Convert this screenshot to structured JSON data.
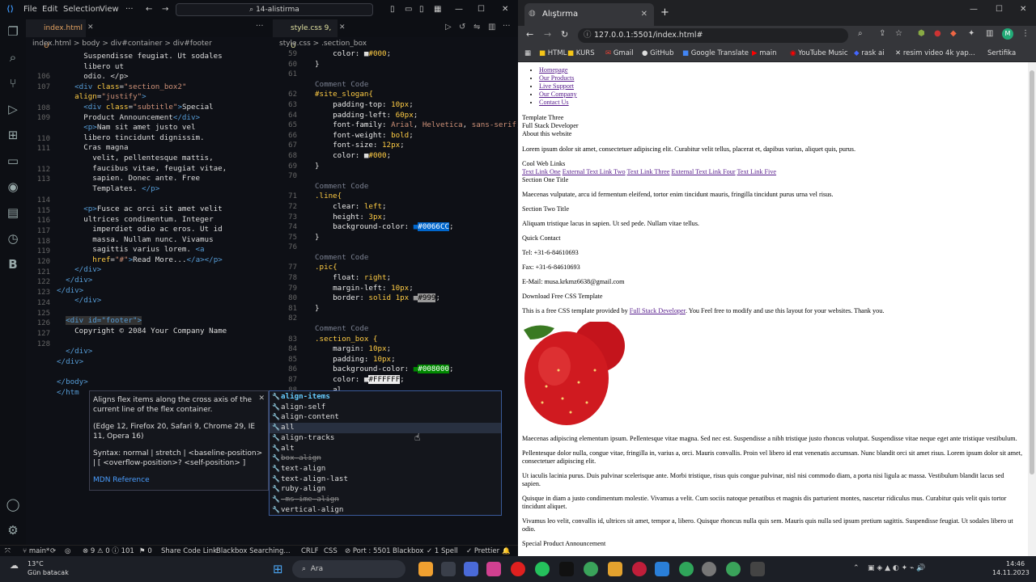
{
  "vscode": {
    "menu": [
      "File",
      "Edit",
      "Selection",
      "View"
    ],
    "search": "14-alistirma",
    "left_tab": "index.html U",
    "right_tab": "style.css 9, U",
    "left_crumb": "index.html > body > div#container > div#footer",
    "right_crumb": "style.css > .section_box",
    "left_gutter": [
      "",
      "",
      "106",
      "107",
      "",
      "108",
      "109",
      "",
      "110",
      "111",
      "",
      "112",
      "113",
      "",
      "114",
      "115",
      "116",
      "117",
      "118",
      "119",
      "120",
      "121",
      "122",
      "123",
      "124",
      "125",
      "126",
      "127",
      "128"
    ],
    "right_gutter": [
      "59",
      "60",
      "61",
      "",
      "62",
      "63",
      "64",
      "65",
      "66",
      "67",
      "68",
      "69",
      "70",
      "",
      "71",
      "72",
      "73",
      "74",
      "75",
      "76",
      "",
      "77",
      "78",
      "79",
      "80",
      "81",
      "82",
      "",
      "83",
      "84",
      "85",
      "86",
      "87",
      "88"
    ],
    "status": {
      "branch": "main*",
      "errors": "9",
      "warnings": "0",
      "info": "101",
      "ports": "0",
      "share": "Share Code Link",
      "blackbox": "Blackbox Searching...",
      "crlf": "CRLF",
      "lang": "CSS",
      "port": "Port : 5501",
      "bb": "Blackbox",
      "spell": "1 Spell",
      "prettier": "Prettier"
    }
  },
  "hover": {
    "desc": "Aligns flex items along the cross axis of the current line of the flex container.",
    "compat": "(Edge 12, Firefox 20, Safari 9, Chrome 29, IE 11, Opera 16)",
    "syntax": "Syntax: normal | stretch | <baseline-position> | [ <overflow-position>? <self-position> ]",
    "link": "MDN Reference"
  },
  "suggestions": [
    "align-items",
    "align-self",
    "align-content",
    "all",
    "align-tracks",
    "alt",
    "box-align",
    "text-align",
    "text-align-last",
    "ruby-align",
    "-ms-ime-align",
    "vertical-align"
  ],
  "browser": {
    "tab_title": "Alıştırma",
    "url": "127.0.0.1:5501/index.html#",
    "bookmarks": [
      "HTML",
      "KURS",
      "Gmail",
      "GitHub",
      "Google Translate",
      "main",
      "YouTube Music",
      "rask ai",
      "resim video 4k yap...",
      "Sertifika"
    ],
    "nav": [
      "Homepage",
      "Our Products",
      "Live Support",
      "Our Company",
      "Contact Us"
    ],
    "template": "Template Three",
    "fullstack": "Full Stack Developer",
    "about": "About this website",
    "lorem1": "Lorem ipsum dolor sit amet, consectetuer adipiscing elit. Curabitur velit tellus, placerat et, dapibus varius, aliquet quis, purus.",
    "cool": "Cool Web Links",
    "links": [
      "Text Link One",
      "External Text Link Two",
      "Text Link Three",
      "External Text Link Four",
      "Text Link Five"
    ],
    "sec1": "Section One Title",
    "sec1_text": "Maecenas vulputate, arcu id fermentum eleifend, tortor enim tincidunt mauris, fringilla tincidunt purus urna vel risus.",
    "sec2": "Section Two Title",
    "sec2_text": "Aliquam tristique lacus in sapien. Ut sed pede. Nullam vitae tellus.",
    "quick": "Quick Contact",
    "tel": "Tel: +31-6-84610693",
    "fax": "Fax: +31-6-84610693",
    "email": "E-Mail: musa.krkmz6638@gmail.com",
    "download": "Download Free CSS Template",
    "free_a": "This is a free CSS template provided by ",
    "free_link": "Full Stack Developer",
    "free_b": ". You Feel free to modify and use this layout for your websites. Thank you.",
    "p1": "Maecenas adipiscing elementum ipsum. Pellentesque vitae magna. Sed nec est. Suspendisse a nibh tristique justo rhoncus volutpat. Suspendisse vitae neque eget ante tristique vestibulum.",
    "p2": "Pellentesque dolor nulla, congue vitae, fringilla in, varius a, orci. Mauris convallis. Proin vel libero id erat venenatis accumsan. Nunc blandit orci sit amet risus. Lorem ipsum dolor sit amet, consectetuer adipiscing elit.",
    "p3": "Ut iaculis lacinia purus. Duis pulvinar scelerisque ante. Morbi tristique, risus quis congue pulvinar, nisl nisi commodo diam, a porta nisi ligula ac massa. Vestibulum blandit lacus sed sapien.",
    "p4": "Quisque in diam a justo condimentum molestie. Vivamus a velit. Cum sociis natoque penatibus et magnis dis parturient montes, nascetur ridiculus mus. Curabitur quis velit quis tortor tincidunt aliquet.",
    "p5": "Vivamus leo velit, convallis id, ultrices sit amet, tempor a, libero. Quisque rhoncus nulla quis sem. Mauris quis nulla sed ipsum pretium sagittis. Suspendisse feugiat. Ut sodales libero ut odio.",
    "special": "Special Product Announcement"
  },
  "taskbar": {
    "weather_temp": "13°C",
    "weather_text": "Gün batacak",
    "search": "Ara",
    "time": "14:46",
    "date": "14.11.2023"
  }
}
